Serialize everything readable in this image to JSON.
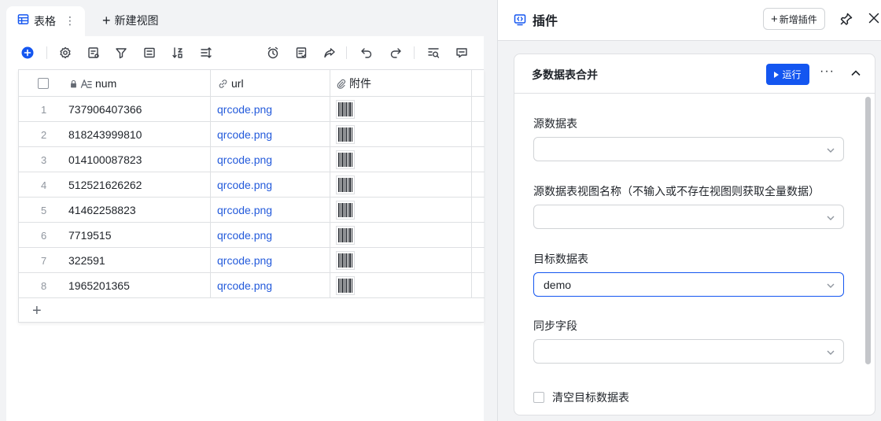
{
  "tabs": {
    "active_label": "表格",
    "more_glyph": "⋮",
    "new_view_label": "新建视图"
  },
  "table": {
    "columns": [
      {
        "label": "num"
      },
      {
        "label": "url"
      },
      {
        "label": "附件"
      }
    ],
    "rows": [
      {
        "index": "1",
        "num": "737906407366",
        "url": "qrcode.png"
      },
      {
        "index": "2",
        "num": "818243999810",
        "url": "qrcode.png"
      },
      {
        "index": "3",
        "num": "014100087823",
        "url": "qrcode.png"
      },
      {
        "index": "4",
        "num": "512521626262",
        "url": "qrcode.png"
      },
      {
        "index": "5",
        "num": "41462258823",
        "url": "qrcode.png"
      },
      {
        "index": "6",
        "num": "7719515",
        "url": "qrcode.png"
      },
      {
        "index": "7",
        "num": "322591",
        "url": "qrcode.png"
      },
      {
        "index": "8",
        "num": "1965201365",
        "url": "qrcode.png"
      }
    ],
    "add_row_glyph": "+"
  },
  "panel": {
    "title": "插件",
    "add_plugin_label": "新增插件",
    "card": {
      "title": "多数据表合并",
      "run_label": "运行",
      "more_glyph": "···",
      "fields": {
        "source_table": {
          "label": "源数据表",
          "value": ""
        },
        "source_view": {
          "label": "源数据表视图名称（不输入或不存在视图则获取全量数据）",
          "value": ""
        },
        "target_table": {
          "label": "目标数据表",
          "value": "demo"
        },
        "sync_fields": {
          "label": "同步字段",
          "value": ""
        }
      },
      "clear_target_label": "清空目标数据表",
      "clear_target_checked": false
    }
  },
  "colors": {
    "accent": "#1456f0",
    "link": "#245bdb",
    "border": "#dee0e3"
  }
}
